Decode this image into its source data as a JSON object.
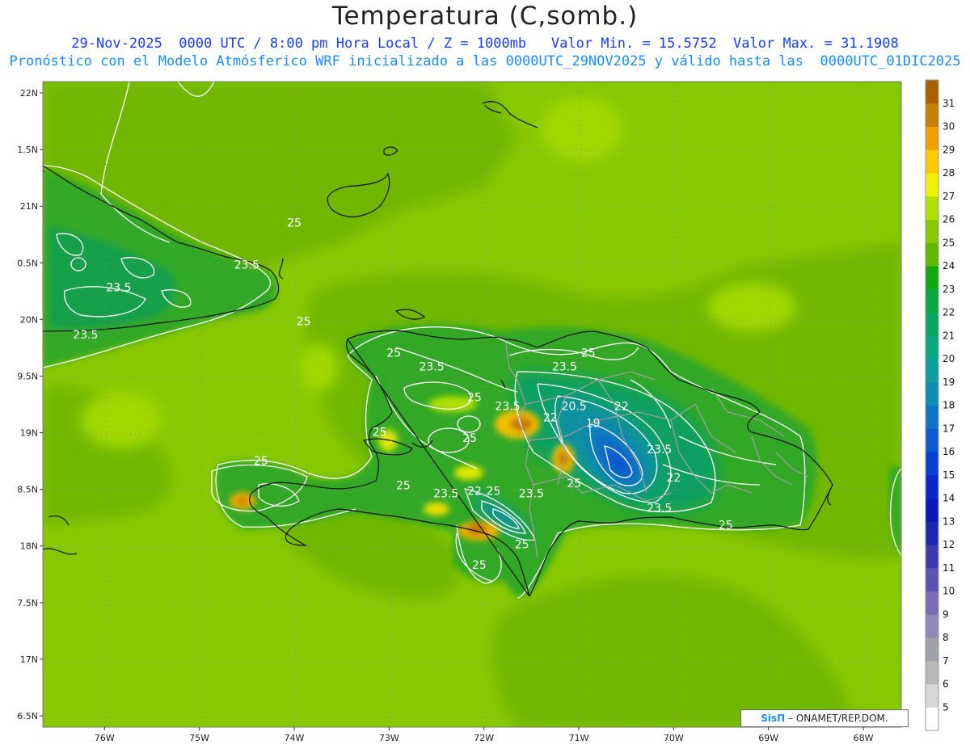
{
  "title": "Temperatura (C,somb.)",
  "subtitle_1": "29-Nov-2025  0000 UTC / 8:00 pm Hora Local / Z = 1000mb   Valor Min. = 15.5752  Valor Max. = 31.1908",
  "subtitle_2": "Pronóstico con el Modelo Atmósferico WRF inicializado a las 0000UTC_29NOV2025 y válido hasta las  0000UTC_01DIC2025",
  "credit": {
    "brand": "SisΠ",
    "text": " – ONAMET/REP.DOM."
  },
  "axes": {
    "lat_ticks": [
      "22N",
      "1.5N",
      "21N",
      "0.5N",
      "20N",
      "9.5N",
      "19N",
      "8.5N",
      "18N",
      "7.5N",
      "17N",
      "6.5N"
    ],
    "lon_ticks": [
      "76W",
      "75W",
      "74W",
      "73W",
      "72W",
      "71W",
      "70W",
      "69W",
      "68W"
    ],
    "lat_range": [
      16.4,
      22.1
    ],
    "lon_range": [
      -76.65,
      -67.6
    ],
    "grid": "dotted"
  },
  "colorbar": {
    "levels": [
      5,
      6,
      7,
      8,
      9,
      10,
      11,
      12,
      13,
      14,
      15,
      16,
      17,
      18,
      19,
      20,
      21,
      22,
      23,
      24,
      25,
      26,
      27,
      28,
      29,
      30,
      31
    ],
    "colors": [
      "#ffffff",
      "#d8d8d8",
      "#b8b8b8",
      "#a0a0a8",
      "#9088b8",
      "#7a6cb8",
      "#5a54b0",
      "#3c3cb0",
      "#1c28b0",
      "#0a18b8",
      "#0828c8",
      "#0a40d0",
      "#0c5ad0",
      "#0c74c4",
      "#0c8eb4",
      "#0ca09c",
      "#0aa880",
      "#08a860",
      "#08a840",
      "#10a810",
      "#60b800",
      "#88c800",
      "#b0e000",
      "#f0f000",
      "#ffc800",
      "#f0a000",
      "#c88000",
      "#a86000"
    ]
  },
  "map": {
    "fields": [
      {
        "name": "cuba",
        "value": 23.5
      },
      {
        "name": "hispaniola",
        "value": 23.5
      },
      {
        "name": "cordillera",
        "value": 19
      },
      {
        "name": "sea_warm",
        "value": 26.5
      }
    ],
    "contour_labels": [
      {
        "text": "25",
        "lon": -74.0,
        "lat": 20.82
      },
      {
        "text": "23.5",
        "lon": -74.5,
        "lat": 20.45
      },
      {
        "text": "23.5",
        "lon": -75.85,
        "lat": 20.25
      },
      {
        "text": "25",
        "lon": -73.9,
        "lat": 19.95
      },
      {
        "text": "23.5",
        "lon": -76.2,
        "lat": 19.83
      },
      {
        "text": "25",
        "lon": -72.95,
        "lat": 19.67
      },
      {
        "text": "23.5",
        "lon": -72.55,
        "lat": 19.55
      },
      {
        "text": "25",
        "lon": -70.9,
        "lat": 19.67
      },
      {
        "text": "23.5",
        "lon": -71.15,
        "lat": 19.55
      },
      {
        "text": "25",
        "lon": -72.1,
        "lat": 19.28
      },
      {
        "text": "23.5",
        "lon": -71.75,
        "lat": 19.2
      },
      {
        "text": "20.5",
        "lon": -71.05,
        "lat": 19.2
      },
      {
        "text": "22",
        "lon": -71.3,
        "lat": 19.1
      },
      {
        "text": "22",
        "lon": -70.55,
        "lat": 19.2
      },
      {
        "text": "19",
        "lon": -70.85,
        "lat": 19.05
      },
      {
        "text": "25",
        "lon": -73.1,
        "lat": 18.97
      },
      {
        "text": "25",
        "lon": -72.15,
        "lat": 18.92
      },
      {
        "text": "23.5",
        "lon": -70.15,
        "lat": 18.82
      },
      {
        "text": "25",
        "lon": -74.35,
        "lat": 18.72
      },
      {
        "text": "25",
        "lon": -72.85,
        "lat": 18.5
      },
      {
        "text": "23.5",
        "lon": -72.4,
        "lat": 18.43
      },
      {
        "text": "22",
        "lon": -72.1,
        "lat": 18.45
      },
      {
        "text": "25",
        "lon": -71.9,
        "lat": 18.45
      },
      {
        "text": "23.5",
        "lon": -71.5,
        "lat": 18.43
      },
      {
        "text": "25",
        "lon": -71.05,
        "lat": 18.52
      },
      {
        "text": "22",
        "lon": -70.0,
        "lat": 18.57
      },
      {
        "text": "23.5",
        "lon": -70.15,
        "lat": 18.3
      },
      {
        "text": "25",
        "lon": -69.45,
        "lat": 18.15
      },
      {
        "text": "25",
        "lon": -71.6,
        "lat": 17.98
      },
      {
        "text": "25",
        "lon": -72.05,
        "lat": 17.8
      }
    ]
  }
}
